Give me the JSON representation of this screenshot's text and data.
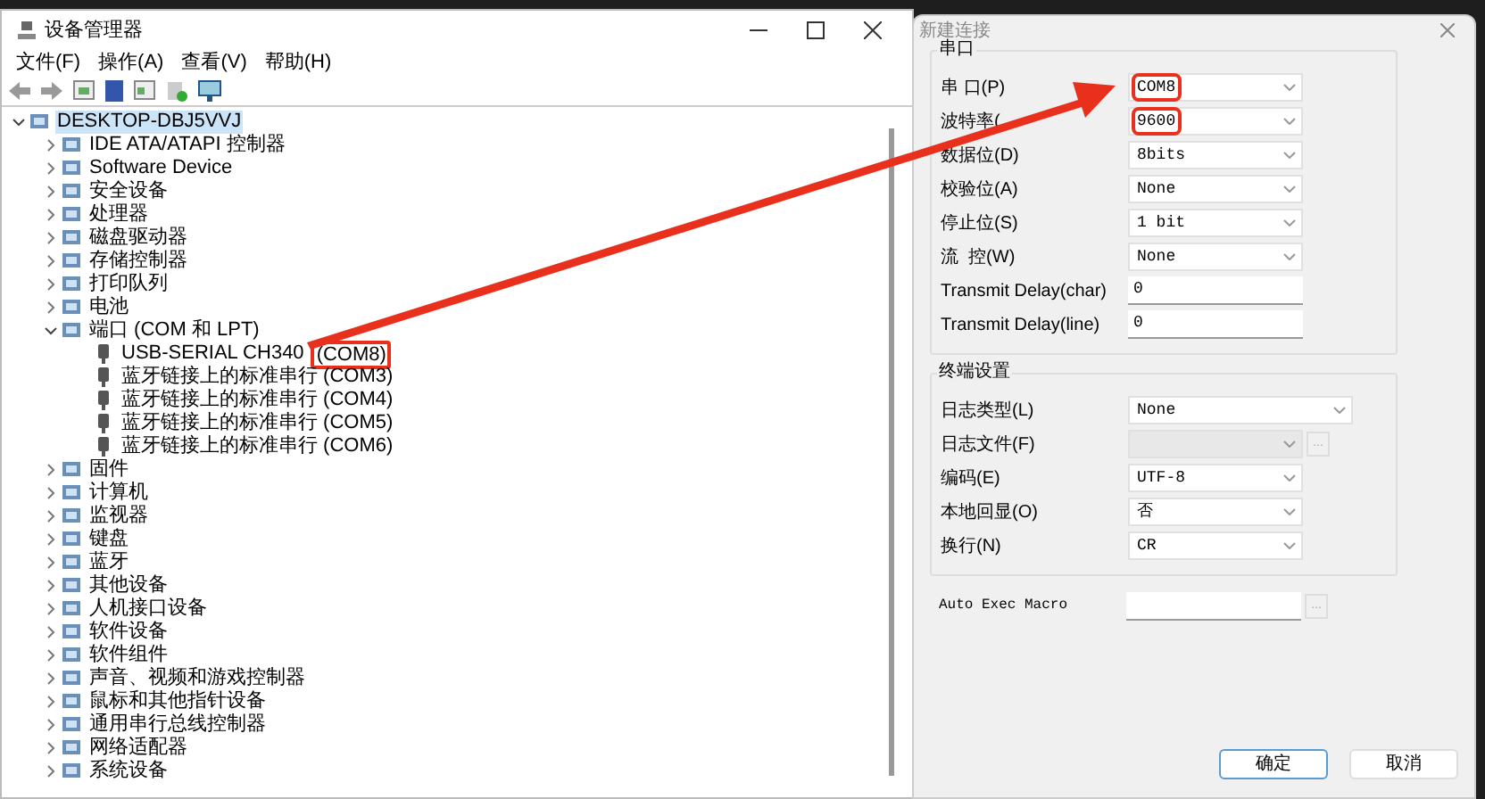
{
  "device_manager": {
    "title": "设备管理器",
    "menu": [
      "文件(F)",
      "操作(A)",
      "查看(V)",
      "帮助(H)"
    ],
    "tree": [
      {
        "label": "DESKTOP-DBJ5VVJ",
        "expanded": true,
        "selected": true,
        "children": [
          {
            "label": "IDE ATA/ATAPI 控制器",
            "expanded": false
          },
          {
            "label": "Software Device",
            "expanded": false
          },
          {
            "label": "安全设备",
            "expanded": false
          },
          {
            "label": "处理器",
            "expanded": false
          },
          {
            "label": "磁盘驱动器",
            "expanded": false
          },
          {
            "label": "存储控制器",
            "expanded": false
          },
          {
            "label": "打印队列",
            "expanded": false
          },
          {
            "label": "电池",
            "expanded": false
          },
          {
            "label": "端口 (COM 和 LPT)",
            "expanded": true,
            "children": [
              {
                "label": "USB-SERIAL CH340",
                "tag": "(COM8)",
                "highlighted": true
              },
              {
                "label": "蓝牙链接上的标准串行 (COM3)"
              },
              {
                "label": "蓝牙链接上的标准串行 (COM4)"
              },
              {
                "label": "蓝牙链接上的标准串行 (COM5)"
              },
              {
                "label": "蓝牙链接上的标准串行 (COM6)"
              }
            ]
          },
          {
            "label": "固件",
            "expanded": false
          },
          {
            "label": "计算机",
            "expanded": false
          },
          {
            "label": "监视器",
            "expanded": false
          },
          {
            "label": "键盘",
            "expanded": false
          },
          {
            "label": "蓝牙",
            "expanded": false
          },
          {
            "label": "其他设备",
            "expanded": false
          },
          {
            "label": "人机接口设备",
            "expanded": false
          },
          {
            "label": "软件设备",
            "expanded": false
          },
          {
            "label": "软件组件",
            "expanded": false
          },
          {
            "label": "声音、视频和游戏控制器",
            "expanded": false
          },
          {
            "label": "鼠标和其他指针设备",
            "expanded": false
          },
          {
            "label": "通用串行总线控制器",
            "expanded": false
          },
          {
            "label": "网络适配器",
            "expanded": false
          },
          {
            "label": "系统设备",
            "expanded": false
          }
        ]
      }
    ]
  },
  "dialog": {
    "title": "新建连接",
    "groups": [
      {
        "title": "串口",
        "fields": [
          {
            "label": "串 口(P)",
            "kind": "select",
            "value": "COM8",
            "highlighted": true
          },
          {
            "label": "波特率(",
            "kind": "select",
            "value": "9600",
            "highlighted": true
          },
          {
            "label": "数据位(D)",
            "kind": "select",
            "value": "8bits"
          },
          {
            "label": "校验位(A)",
            "kind": "select",
            "value": "None"
          },
          {
            "label": "停止位(S)",
            "kind": "select",
            "value": "1 bit"
          },
          {
            "label": "流  控(W)",
            "kind": "select",
            "value": "None"
          },
          {
            "label": "Transmit Delay(char)",
            "kind": "input",
            "value": "0"
          },
          {
            "label": "Transmit Delay(line)",
            "kind": "input",
            "value": "0"
          }
        ]
      },
      {
        "title": "终端设置",
        "fields": [
          {
            "label": "日志类型(L)",
            "kind": "select",
            "value": "None",
            "wide": true
          },
          {
            "label": "日志文件(F)",
            "kind": "select",
            "disabled": true,
            "browse": "..."
          },
          {
            "label": "编码(E)",
            "kind": "select",
            "value": "UTF-8"
          },
          {
            "label": "本地回显(O)",
            "kind": "select",
            "value": "否"
          },
          {
            "label": "换行(N)",
            "kind": "select",
            "value": "CR"
          }
        ]
      }
    ],
    "macro": {
      "label": "Auto Exec Macro",
      "browse": "..."
    },
    "buttons": [
      {
        "label": "确定",
        "default": true
      },
      {
        "label": "取消",
        "default": false
      }
    ]
  }
}
